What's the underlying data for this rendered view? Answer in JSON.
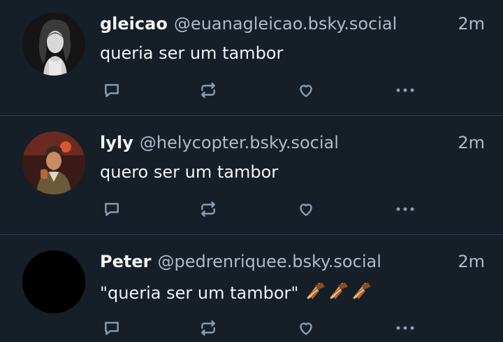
{
  "posts": [
    {
      "display_name": "gleicao",
      "handle": "@euanagleicao.bsky.social",
      "time": "2m",
      "text": "queria ser um tambor",
      "avatar_icon": "avatar-bw-portrait"
    },
    {
      "display_name": "lyly",
      "handle": "@helycopter.bsky.social",
      "time": "2m",
      "text": "quero ser um tambor",
      "avatar_icon": "avatar-color-photo"
    },
    {
      "display_name": "Peter",
      "handle": "@pedrenriquee.bsky.social",
      "time": "2m",
      "text": "\"queria ser um tambor\"",
      "emoji": "🪘🪘🪘",
      "avatar_icon": "avatar-black"
    }
  ],
  "icons": {
    "reply": "reply-icon",
    "repost": "repost-icon",
    "like": "heart-icon",
    "more": "more-icon"
  },
  "colors": {
    "background": "#161e27",
    "text": "#f1f3f5",
    "muted": "#aebbc9",
    "icon": "#8a9eb3",
    "divider": "#2e4052"
  }
}
